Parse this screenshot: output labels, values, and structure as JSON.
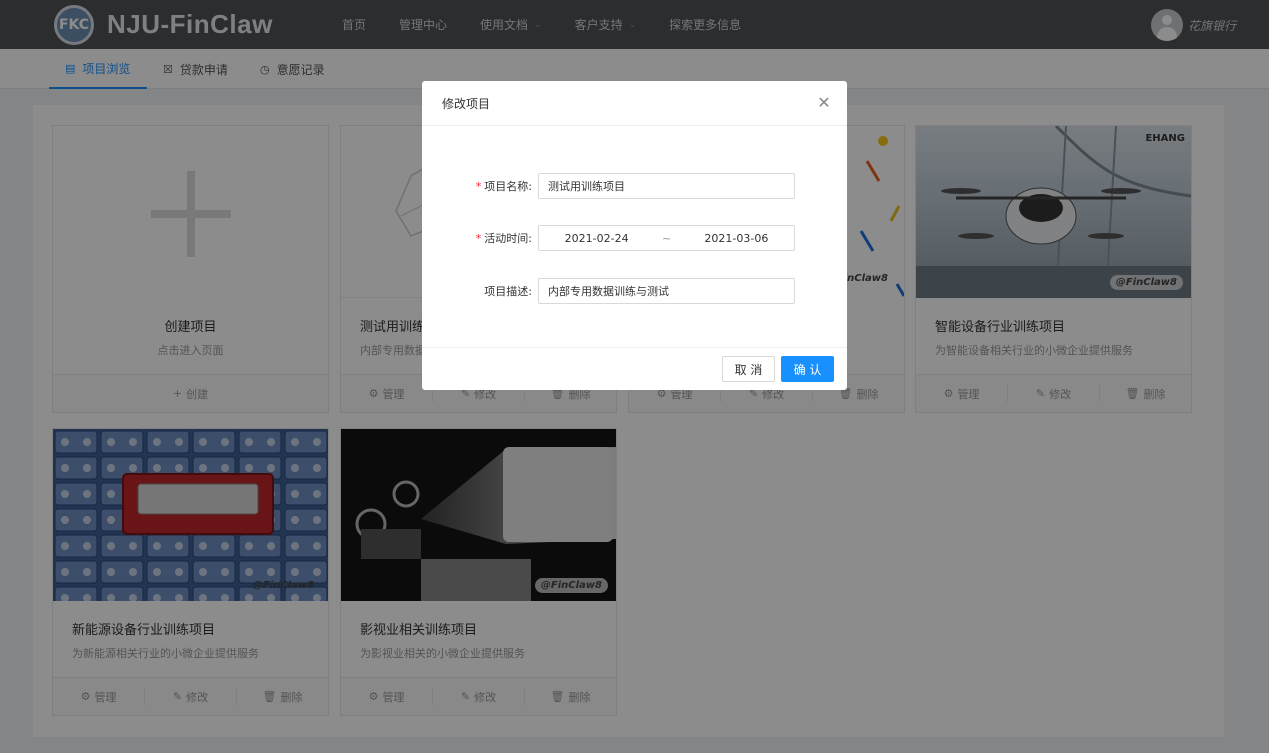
{
  "header": {
    "logo_text": "FKC",
    "brand": "NJU-FinClaw",
    "nav": [
      {
        "label": "首页",
        "has_dropdown": false
      },
      {
        "label": "管理中心",
        "has_dropdown": false
      },
      {
        "label": "使用文档",
        "has_dropdown": true
      },
      {
        "label": "客户支持",
        "has_dropdown": true
      },
      {
        "label": "探索更多信息",
        "has_dropdown": false
      }
    ],
    "user_name": "花旗银行"
  },
  "tabs": [
    {
      "label": "项目浏览",
      "icon": "project-icon",
      "active": true
    },
    {
      "label": "贷款申请",
      "icon": "loan-icon",
      "active": false
    },
    {
      "label": "意愿记录",
      "icon": "history-icon",
      "active": false
    }
  ],
  "cards": {
    "create": {
      "title": "创建项目",
      "desc": "点击进入页面",
      "action": "创建"
    },
    "actions": {
      "manage": "管理",
      "edit": "修改",
      "delete": "删除"
    },
    "watermark": "@FinClaw8",
    "cover_brand": "EHANG",
    "items": [
      {
        "title": "测试用训练项目",
        "desc": "内部专用数据训练与测试"
      },
      {
        "title": "",
        "desc": ""
      },
      {
        "title": "智能设备行业训练项目",
        "desc": "为智能设备相关行业的小微企业提供服务"
      },
      {
        "title": "新能源设备行业训练项目",
        "desc": "为新能源相关行业的小微企业提供服务"
      },
      {
        "title": "影视业相关训练项目",
        "desc": "为影视业相关的小微企业提供服务"
      }
    ]
  },
  "modal": {
    "title": "修改项目",
    "fields": {
      "name_label": "项目名称:",
      "name_value": "测试用训练项目",
      "time_label": "活动时间:",
      "start_date": "2021-02-24",
      "range_sep": "~",
      "end_date": "2021-03-06",
      "desc_label": "项目描述:",
      "desc_value": "内部专用数据训练与测试"
    },
    "required_mark": "*",
    "cancel": "取 消",
    "ok": "确 认"
  },
  "colors": {
    "primary": "#1890ff",
    "header_bg": "#4f5357",
    "required": "#f5222d"
  }
}
